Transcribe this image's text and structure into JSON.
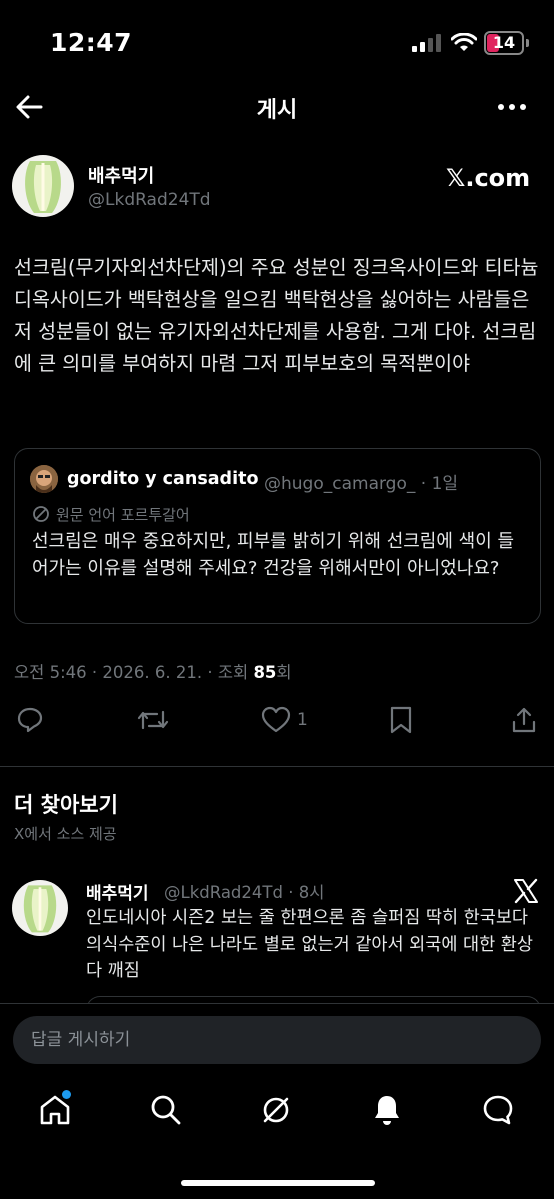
{
  "status_bar": {
    "time": "12:47",
    "battery_level": "14"
  },
  "header": {
    "title": "게시"
  },
  "post": {
    "author_name": "배추먹기",
    "author_handle": "@LkdRad24Td",
    "source_badge": "𝕏.com",
    "text": "선크림(무기자외선차단제)의 주요 성분인 징크옥사이드와 티타늄디옥사이드가 백탁현상을 일으킴 백탁현상을 싫어하는 사람들은 저 성분들이 없는 유기자외선차단제를 사용함. 그게 다야. 선크림에 큰 의미를 부여하지 마렴 그저 피부보호의 목적뿐이야",
    "meta_prefix": "오전 5:46 · 2026. 6. 21. · 조회 ",
    "views": "85",
    "meta_suffix": "회",
    "like_count": "1"
  },
  "quote": {
    "author_name": "gordito y cansadito",
    "meta": "@hugo_camargo_ · 1일",
    "translated_label": "원문 언어 포르투갈어",
    "text": "선크림은 매우 중요하지만, 피부를 밝히기 위해 선크림에 색이 들어가는 이유를 설명해 주세요? 건강을 위해서만이 아니었나요?"
  },
  "discover": {
    "title": "더 찾아보기",
    "subtitle": "X에서 소스 제공"
  },
  "recommended": {
    "author_name": "배추먹기",
    "meta": "@LkdRad24Td · 8시",
    "text": "인도네시아 시즌2 보는 줄 한편으론 좀 슬퍼짐 딱히 한국보다 의식수준이 나은 나라도 별로 없는거 같아서 외국에 대한 환상 다 깨짐"
  },
  "reply": {
    "placeholder": "답글 게시하기"
  },
  "colors": {
    "accent": "#1d9bf0",
    "background": "#000000",
    "muted": "#71767b"
  },
  "icons": [
    "back-arrow-icon",
    "more-icon",
    "translate-icon",
    "reply-icon",
    "retweet-icon",
    "heart-icon",
    "bookmark-icon",
    "share-icon",
    "x-logo-icon",
    "home-icon",
    "search-icon",
    "grok-icon",
    "bell-icon",
    "messages-icon"
  ]
}
